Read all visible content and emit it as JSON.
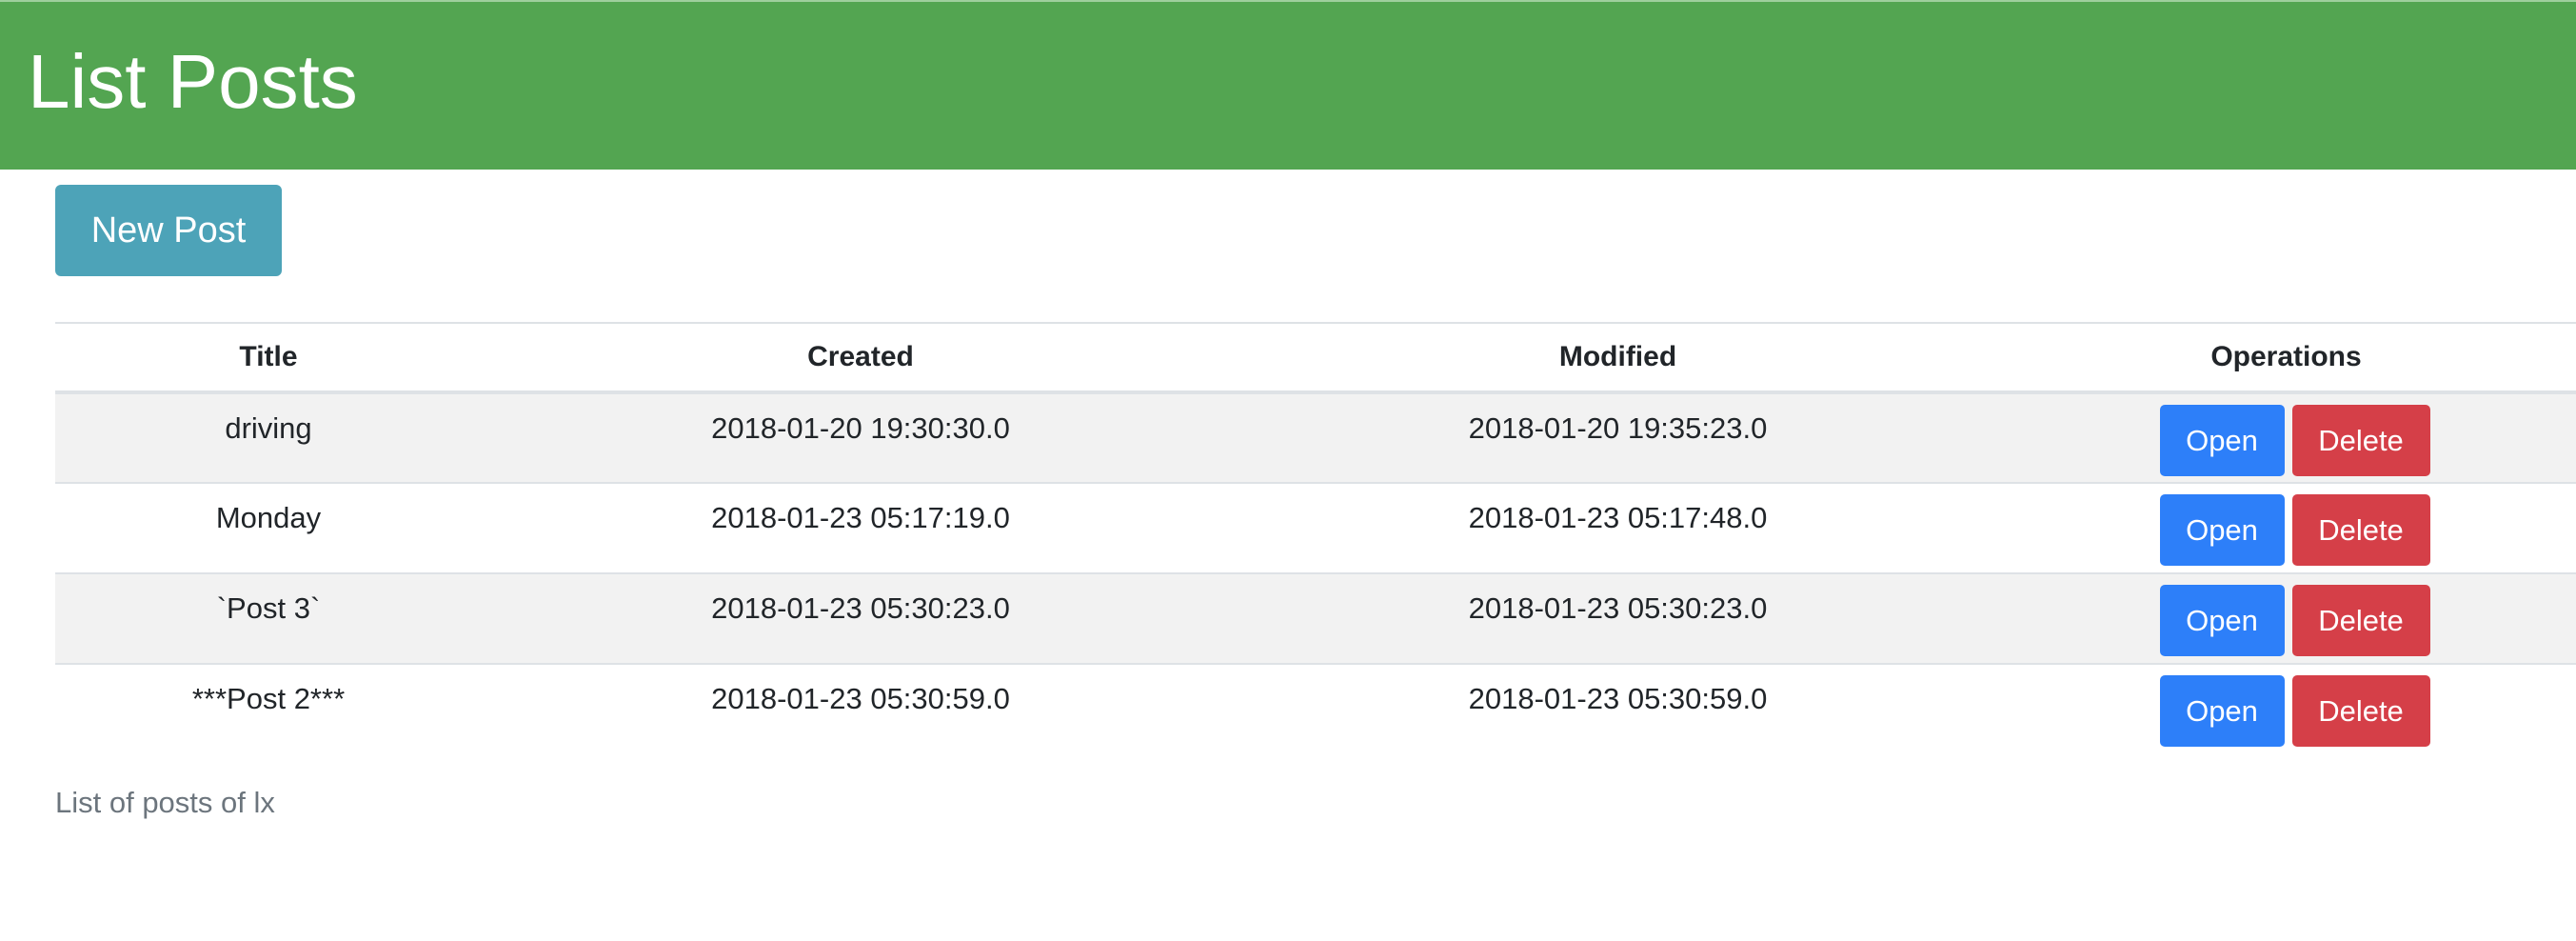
{
  "header": {
    "title": "List Posts"
  },
  "toolbar": {
    "new_post_label": "New Post"
  },
  "table": {
    "columns": [
      "Title",
      "Created",
      "Modified",
      "Operations"
    ],
    "rows": [
      {
        "title": "driving",
        "created": "2018-01-20 19:30:30.0",
        "modified": "2018-01-20 19:35:23.0",
        "open_label": "Open",
        "delete_label": "Delete"
      },
      {
        "title": "Monday",
        "created": "2018-01-23 05:17:19.0",
        "modified": "2018-01-23 05:17:48.0",
        "open_label": "Open",
        "delete_label": "Delete"
      },
      {
        "title": "`Post 3`",
        "created": "2018-01-23 05:30:23.0",
        "modified": "2018-01-23 05:30:23.0",
        "open_label": "Open",
        "delete_label": "Delete"
      },
      {
        "title": "***Post 2***",
        "created": "2018-01-23 05:30:59.0",
        "modified": "2018-01-23 05:30:59.0",
        "open_label": "Open",
        "delete_label": "Delete"
      }
    ]
  },
  "caption": "List of posts of lx",
  "colors": {
    "header_bg": "#53a551",
    "new_post_bg": "#4da3b8",
    "open_bg": "#2d7ff9",
    "delete_bg": "#d53f48",
    "stripe_bg": "#f2f2f2"
  }
}
